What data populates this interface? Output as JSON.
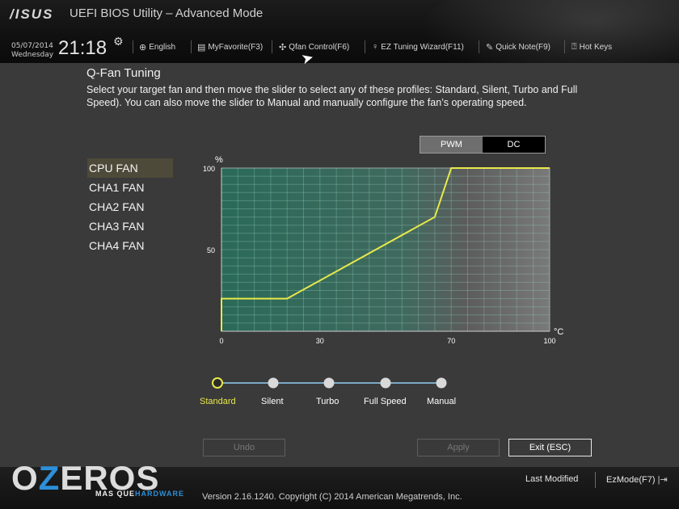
{
  "header": {
    "brand": "/ISUS",
    "title": "UEFI BIOS Utility – Advanced Mode",
    "date": "05/07/2014",
    "weekday": "Wednesday",
    "time": "21:18",
    "toolbar": [
      {
        "label": "English",
        "icon": "globe-icon"
      },
      {
        "label": "MyFavorite(F3)",
        "icon": "favorite-icon"
      },
      {
        "label": "Qfan Control(F6)",
        "icon": "fan-icon"
      },
      {
        "label": "EZ Tuning Wizard(F11)",
        "icon": "bulb-icon"
      },
      {
        "label": "Quick Note(F9)",
        "icon": "note-icon"
      },
      {
        "label": "Hot Keys",
        "icon": "question-icon"
      }
    ]
  },
  "qfan": {
    "title": "Q-Fan Tuning",
    "description": "Select your target fan and then move the slider to select any of these profiles: Standard, Silent, Turbo and Full Speed). You can also move the slider to Manual and manually configure the fan’s operating speed.",
    "modes": [
      "PWM",
      "DC"
    ],
    "selected_mode": "DC",
    "fans": [
      "CPU FAN",
      "CHA1 FAN",
      "CHA2 FAN",
      "CHA3 FAN",
      "CHA4 FAN"
    ],
    "selected_fan": "CPU FAN"
  },
  "chart_data": {
    "type": "line",
    "ylabel": "%",
    "xlabel": "°C",
    "xlim": [
      0,
      100
    ],
    "ylim": [
      0,
      100
    ],
    "x_ticks": [
      0,
      30,
      70,
      100
    ],
    "y_ticks": [
      50,
      100
    ],
    "x_tick_labels": [
      "0",
      "30",
      "70",
      "100"
    ],
    "y_tick_labels": [
      "50",
      "100"
    ],
    "grid": true,
    "series": [
      {
        "color": "#e8e84a",
        "x": [
          0,
          0,
          20,
          65,
          70,
          100
        ],
        "y": [
          0,
          20,
          20,
          70,
          100,
          100
        ]
      }
    ]
  },
  "profiles": {
    "options": [
      "Standard",
      "Silent",
      "Turbo",
      "Full Speed",
      "Manual"
    ],
    "selected": "Standard"
  },
  "buttons": {
    "undo": "Undo",
    "apply": "Apply",
    "exit": "Exit (ESC)"
  },
  "footer": {
    "copyright": "Version 2.16.1240. Copyright (C) 2014 American Megatrends, Inc.",
    "last_modified": "Last Modified",
    "ez_mode": "EzMode(F7)",
    "watermark_main_1": "O",
    "watermark_main_z": "Z",
    "watermark_main_2": "EROS",
    "watermark_sub_1": "MAS QUE",
    "watermark_sub_2": "HARDWARE"
  },
  "colors": {
    "accent": "#e8e84a",
    "plot_fill": "#2f6e5c",
    "grid": "#5c9c8a"
  }
}
